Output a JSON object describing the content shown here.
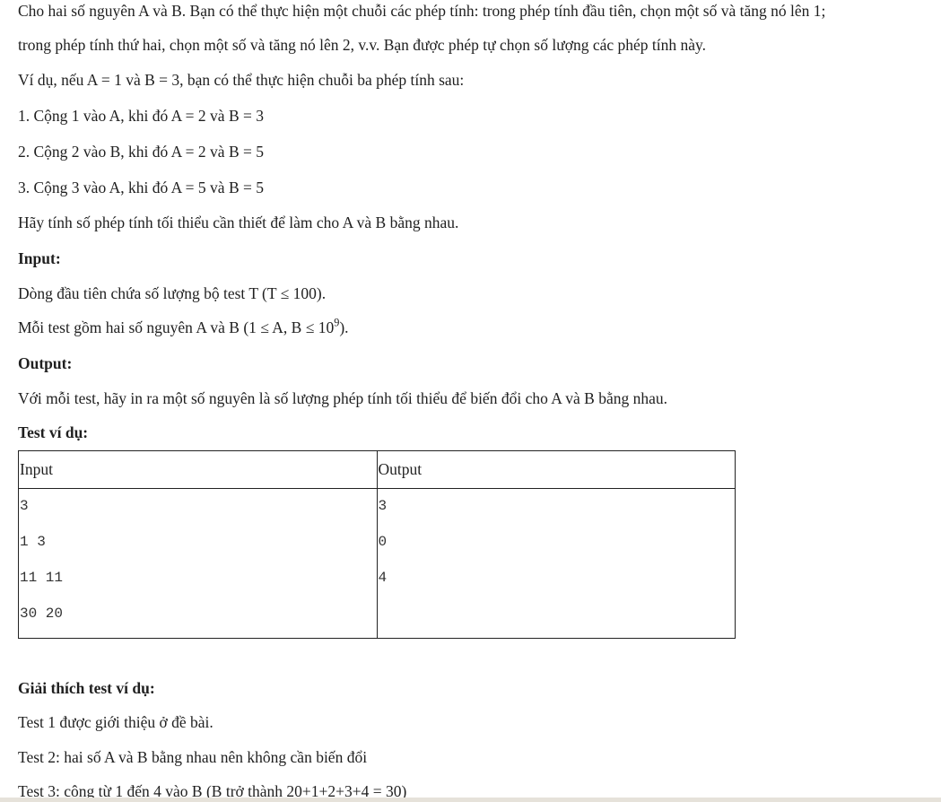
{
  "problem": {
    "intro_line1": "Cho hai số nguyên A và B. Bạn có thể thực hiện một chuỗi các phép tính: trong phép tính đầu tiên, chọn một số và tăng nó lên 1;",
    "intro_line2": "trong phép tính thứ hai, chọn một số và tăng nó lên 2, v.v. Bạn được phép tự chọn số lượng các phép tính này.",
    "example_intro": "Ví dụ, nếu A = 1 và B = 3, bạn có thể thực hiện chuỗi ba phép tính sau:",
    "steps": [
      "1. Cộng 1 vào A, khi đó A = 2 và B = 3",
      "2. Cộng 2 vào B, khi đó A = 2 và B = 5",
      "3. Cộng 3 vào A, khi đó A = 5 và B = 5"
    ],
    "task": "Hãy tính số phép tính tối thiểu cần thiết để làm cho A và B bằng nhau."
  },
  "input_section": {
    "heading": "Input:",
    "line1": "Dòng đầu tiên chứa số lượng bộ test T (T ≤ 100).",
    "line2_prefix": "Mỗi test gồm hai số nguyên A và B (1 ≤ A, B ≤ 10",
    "line2_exponent": "9",
    "line2_suffix": ")."
  },
  "output_section": {
    "heading": "Output:",
    "line1": "Với mỗi test, hãy in ra một số nguyên là số lượng phép tính tối thiểu để biến đổi cho A và B bằng nhau."
  },
  "sample": {
    "heading": "Test ví dụ:",
    "col_input": "Input",
    "col_output": "Output",
    "input_lines": [
      "3",
      "1 3",
      "11 11",
      "30 20"
    ],
    "output_lines": [
      "3",
      "0",
      "4"
    ]
  },
  "explanation": {
    "heading": "Giải thích test ví dụ:",
    "lines": [
      "Test 1 được giới thiệu ở đề bài.",
      "Test 2: hai số A và B bằng nhau nên không cần biến đổi",
      "Test 3: cộng từ 1 đến 4 vào B (B trở thành 20+1+2+3+4 = 30)"
    ]
  }
}
